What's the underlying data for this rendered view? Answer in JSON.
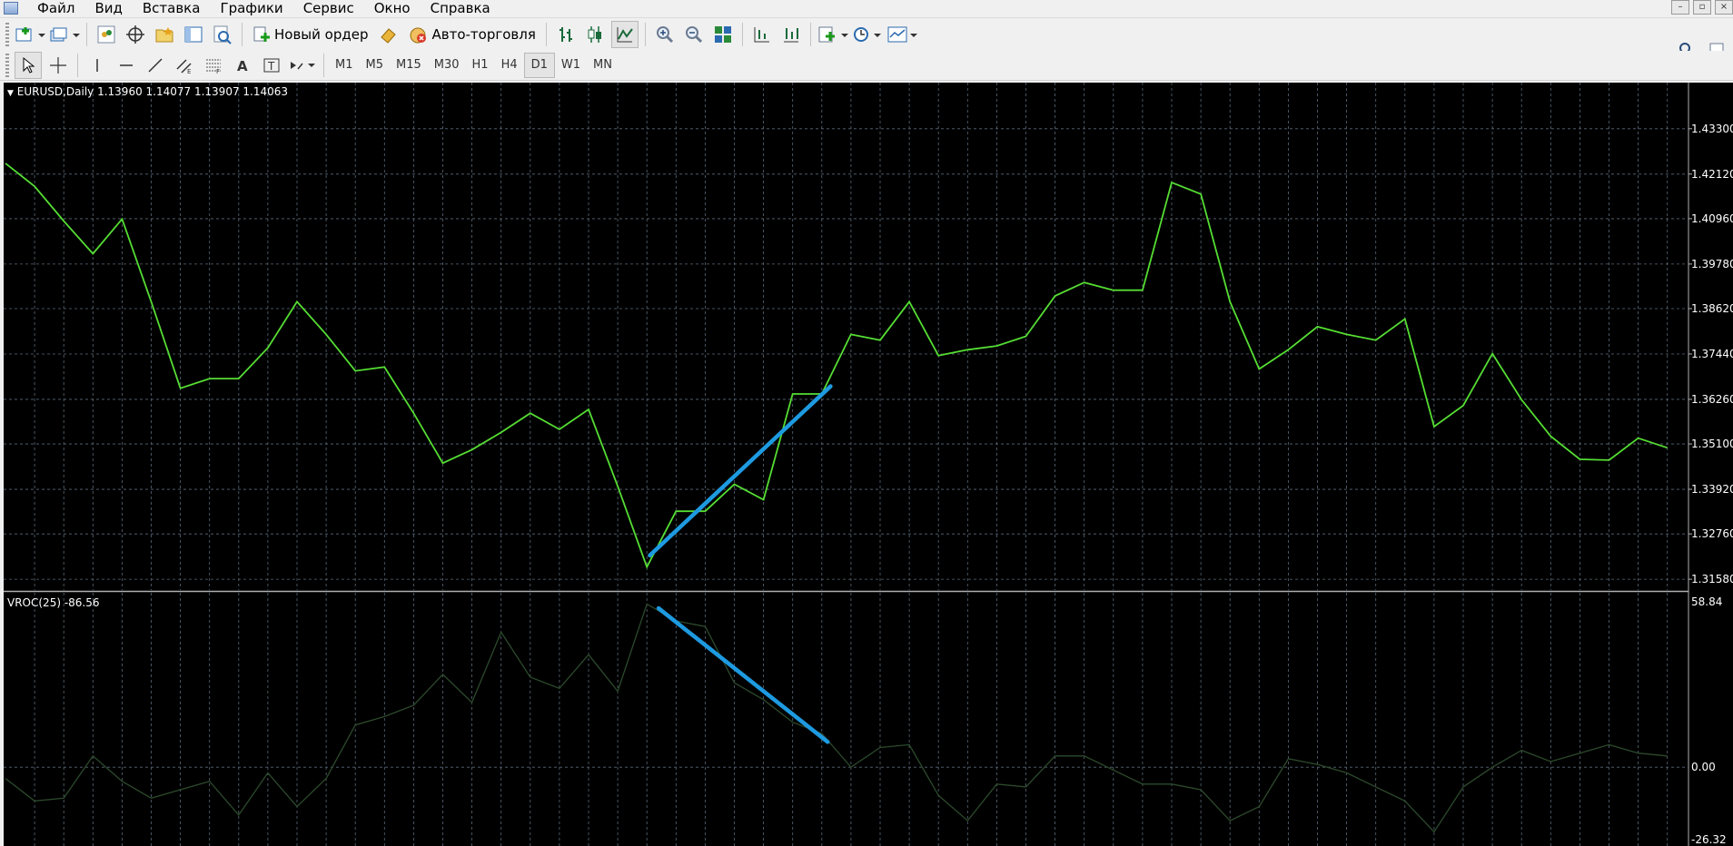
{
  "menu": {
    "items": [
      "Файл",
      "Вид",
      "Вставка",
      "Графики",
      "Сервис",
      "Окно",
      "Справка"
    ]
  },
  "toolbar": {
    "new_order_label": "Новый ордер",
    "auto_trading_label": "Авто-торговля"
  },
  "timeframes": {
    "items": [
      "M1",
      "M5",
      "M15",
      "M30",
      "H1",
      "H4",
      "D1",
      "W1",
      "MN"
    ],
    "active": "D1"
  },
  "chart": {
    "title": "EURUSD,Daily  1.13960 1.14077 1.13907 1.14063",
    "indicator_title": "VROC(25) -86.56"
  },
  "colors": {
    "background": "#000000",
    "price_line": "#55dd33",
    "indicator_line": "#2c4a2c",
    "trend_line": "#1e9ae0",
    "grid": "#5a6a7a",
    "axis_text": "#ffffff"
  },
  "chart_data": [
    {
      "type": "line",
      "panel": "main",
      "y_ticks": [
        "1.43300",
        "1.42120",
        "1.40960",
        "1.39780",
        "1.38620",
        "1.37440",
        "1.36260",
        "1.35100",
        "1.33920",
        "1.32760",
        "1.31580"
      ],
      "ylim": [
        1.313,
        1.445
      ],
      "series": [
        {
          "values": [
            1.424,
            1.418,
            1.409,
            1.4005,
            1.4095,
            1.388,
            1.3655,
            1.368,
            1.368,
            1.376,
            1.388,
            1.3795,
            1.37,
            1.371,
            1.359,
            1.346,
            1.3495,
            1.354,
            1.359,
            1.3548,
            1.36,
            1.34,
            1.319,
            1.3335,
            1.3335,
            1.3405,
            1.3365,
            1.364,
            1.364,
            1.3795,
            1.378,
            1.388,
            1.374,
            1.3755,
            1.3765,
            1.379,
            1.3895,
            1.393,
            1.391,
            1.391,
            1.419,
            1.416,
            1.388,
            1.3705,
            1.3755,
            1.3815,
            1.3795,
            1.378,
            1.3835,
            1.3555,
            1.361,
            1.3745,
            1.3625,
            1.353,
            1.347,
            1.3468,
            1.3525,
            1.35
          ]
        }
      ],
      "annotations": [
        {
          "type": "trendline",
          "from": [
            22.1,
            1.322
          ],
          "to": [
            28.3,
            1.366
          ]
        }
      ]
    },
    {
      "type": "line",
      "panel": "indicator",
      "title": "VROC(25)",
      "y_ticks": [
        "58.84",
        "0.00",
        "-26.32"
      ],
      "ylim": [
        -28.0,
        62.0
      ],
      "series": [
        {
          "values": [
            -4,
            -12,
            -11,
            4,
            -5,
            -11,
            -8,
            -5,
            -17,
            -2,
            -14,
            -4,
            15,
            18,
            22,
            33,
            23,
            48,
            32,
            28,
            40,
            27,
            58,
            52,
            50,
            30,
            24,
            16,
            12,
            0,
            7,
            8,
            -10,
            -19,
            -6,
            -7,
            4,
            4,
            -1,
            -6,
            -6,
            -8,
            -19,
            -14,
            3,
            1,
            -2,
            -7,
            -12,
            -23,
            -7,
            0,
            6,
            2,
            5,
            8,
            5,
            4
          ]
        }
      ],
      "annotations": [
        {
          "type": "trendline",
          "from": [
            22.4,
            56.5
          ],
          "to": [
            28.2,
            9.0
          ]
        }
      ]
    }
  ]
}
